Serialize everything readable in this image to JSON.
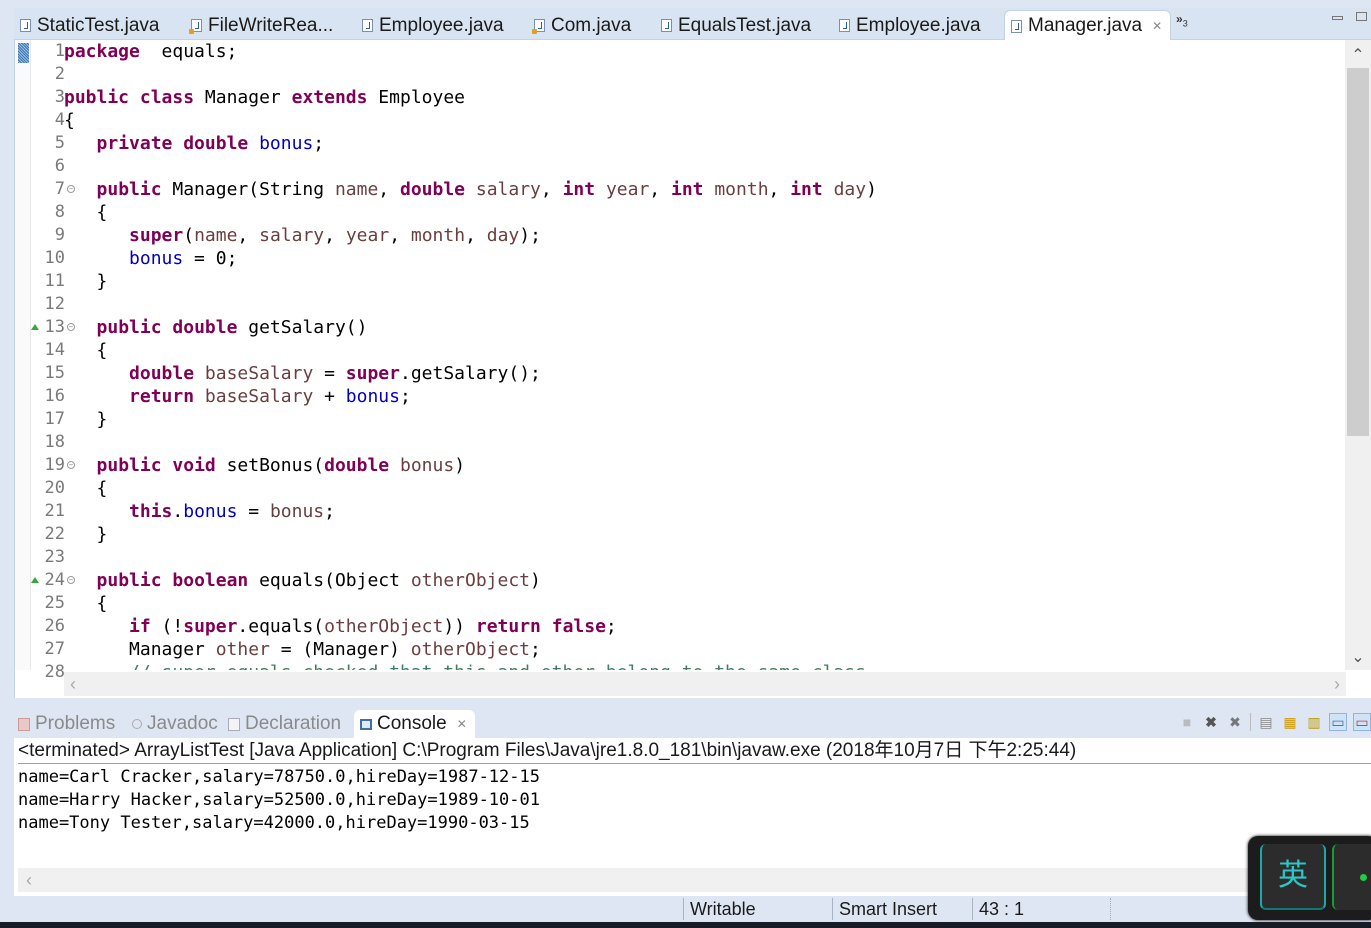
{
  "editor_tabs": [
    {
      "label": "StaticTest.java",
      "icon": "java-file-icon",
      "warning": false,
      "active": false
    },
    {
      "label": "FileWriteRea...",
      "icon": "java-file-icon",
      "warning": true,
      "active": false
    },
    {
      "label": "Employee.java",
      "icon": "java-file-icon",
      "warning": false,
      "active": false
    },
    {
      "label": "Com.java",
      "icon": "java-file-icon",
      "warning": true,
      "active": false
    },
    {
      "label": "EqualsTest.java",
      "icon": "java-file-icon",
      "warning": false,
      "active": false
    },
    {
      "label": "Employee.java",
      "icon": "java-file-icon",
      "warning": false,
      "active": false
    },
    {
      "label": "Manager.java",
      "icon": "java-file-icon",
      "warning": false,
      "active": true
    }
  ],
  "tab_close_glyph": "✕",
  "tab_overflow": {
    "glyph": "»",
    "count": "3"
  },
  "editor": {
    "line_numbers": [
      "1",
      "2",
      "3",
      "4",
      "5",
      "6",
      "7",
      "8",
      "9",
      "10",
      "11",
      "12",
      "13",
      "14",
      "15",
      "16",
      "17",
      "18",
      "19",
      "20",
      "21",
      "22",
      "23",
      "24",
      "25",
      "26",
      "27",
      "28"
    ],
    "fold_lines": [
      7,
      13,
      19,
      24
    ],
    "override_lines": [
      13,
      24
    ],
    "code_lines": [
      [
        [
          "kw",
          "package"
        ],
        [
          "",
          "  equals;"
        ]
      ],
      [],
      [
        [
          "kw",
          "public"
        ],
        [
          "",
          " "
        ],
        [
          "kw",
          "class"
        ],
        [
          "",
          " Manager "
        ],
        [
          "kw",
          "extends"
        ],
        [
          "",
          " Employee"
        ]
      ],
      [
        [
          "",
          "{"
        ]
      ],
      [
        [
          "",
          "   "
        ],
        [
          "kw",
          "private"
        ],
        [
          "",
          " "
        ],
        [
          "kw",
          "double"
        ],
        [
          "",
          " "
        ],
        [
          "fld",
          "bonus"
        ],
        [
          "",
          ";"
        ]
      ],
      [],
      [
        [
          "",
          "   "
        ],
        [
          "kw",
          "public"
        ],
        [
          "",
          " Manager(String "
        ],
        [
          "var",
          "name"
        ],
        [
          "",
          ", "
        ],
        [
          "kw",
          "double"
        ],
        [
          "",
          " "
        ],
        [
          "var",
          "salary"
        ],
        [
          "",
          ", "
        ],
        [
          "kw",
          "int"
        ],
        [
          "",
          " "
        ],
        [
          "var",
          "year"
        ],
        [
          "",
          ", "
        ],
        [
          "kw",
          "int"
        ],
        [
          "",
          " "
        ],
        [
          "var",
          "month"
        ],
        [
          "",
          ", "
        ],
        [
          "kw",
          "int"
        ],
        [
          "",
          " "
        ],
        [
          "var",
          "day"
        ],
        [
          "",
          ")"
        ]
      ],
      [
        [
          "",
          "   {"
        ]
      ],
      [
        [
          "",
          "      "
        ],
        [
          "kw",
          "super"
        ],
        [
          "",
          "("
        ],
        [
          "var",
          "name"
        ],
        [
          "",
          ", "
        ],
        [
          "var",
          "salary"
        ],
        [
          "",
          ", "
        ],
        [
          "var",
          "year"
        ],
        [
          "",
          ", "
        ],
        [
          "var",
          "month"
        ],
        [
          "",
          ", "
        ],
        [
          "var",
          "day"
        ],
        [
          "",
          ");"
        ]
      ],
      [
        [
          "",
          "      "
        ],
        [
          "fld",
          "bonus"
        ],
        [
          "",
          " = 0;"
        ]
      ],
      [
        [
          "",
          "   }"
        ]
      ],
      [],
      [
        [
          "",
          "   "
        ],
        [
          "kw",
          "public"
        ],
        [
          "",
          " "
        ],
        [
          "kw",
          "double"
        ],
        [
          "",
          " getSalary()"
        ]
      ],
      [
        [
          "",
          "   {"
        ]
      ],
      [
        [
          "",
          "      "
        ],
        [
          "kw",
          "double"
        ],
        [
          "",
          " "
        ],
        [
          "var",
          "baseSalary"
        ],
        [
          "",
          " = "
        ],
        [
          "kw",
          "super"
        ],
        [
          "",
          ".getSalary();"
        ]
      ],
      [
        [
          "",
          "      "
        ],
        [
          "kw",
          "return"
        ],
        [
          "",
          " "
        ],
        [
          "var",
          "baseSalary"
        ],
        [
          "",
          " + "
        ],
        [
          "fld",
          "bonus"
        ],
        [
          "",
          ";"
        ]
      ],
      [
        [
          "",
          "   }"
        ]
      ],
      [],
      [
        [
          "",
          "   "
        ],
        [
          "kw",
          "public"
        ],
        [
          "",
          " "
        ],
        [
          "kw",
          "void"
        ],
        [
          "",
          " setBonus("
        ],
        [
          "kw",
          "double"
        ],
        [
          "",
          " "
        ],
        [
          "var",
          "bonus"
        ],
        [
          "",
          ")"
        ]
      ],
      [
        [
          "",
          "   {"
        ]
      ],
      [
        [
          "",
          "      "
        ],
        [
          "kw",
          "this"
        ],
        [
          "",
          "."
        ],
        [
          "fld",
          "bonus"
        ],
        [
          "",
          " = "
        ],
        [
          "var",
          "bonus"
        ],
        [
          "",
          ";"
        ]
      ],
      [
        [
          "",
          "   }"
        ]
      ],
      [],
      [
        [
          "",
          "   "
        ],
        [
          "kw",
          "public"
        ],
        [
          "",
          " "
        ],
        [
          "kw",
          "boolean"
        ],
        [
          "",
          " equals(Object "
        ],
        [
          "var",
          "otherObject"
        ],
        [
          "",
          ")"
        ]
      ],
      [
        [
          "",
          "   {"
        ]
      ],
      [
        [
          "",
          "      "
        ],
        [
          "kw",
          "if"
        ],
        [
          "",
          " (!"
        ],
        [
          "kw",
          "super"
        ],
        [
          "",
          ".equals("
        ],
        [
          "var",
          "otherObject"
        ],
        [
          "",
          ")) "
        ],
        [
          "kw",
          "return"
        ],
        [
          "",
          " "
        ],
        [
          "kw",
          "false"
        ],
        [
          "",
          ";"
        ]
      ],
      [
        [
          "",
          "      Manager "
        ],
        [
          "var",
          "other"
        ],
        [
          "",
          " = (Manager) "
        ],
        [
          "var",
          "otherObject"
        ],
        [
          "",
          ";"
        ]
      ],
      [
        [
          "",
          "      "
        ],
        [
          "cmt",
          "// super.equals checked that this and other belong to the same class"
        ]
      ]
    ]
  },
  "bottom_panel": {
    "tabs": [
      {
        "label": "Problems",
        "icon": "problems-icon",
        "active": false
      },
      {
        "label": "Javadoc",
        "icon": "javadoc-icon",
        "active": false
      },
      {
        "label": "Declaration",
        "icon": "declaration-icon",
        "active": false
      },
      {
        "label": "Console",
        "icon": "console-icon",
        "active": true
      }
    ],
    "toolbar": [
      "terminate-icon",
      "remove-launch-icon",
      "remove-all-terminated-icon",
      "clear-console-icon",
      "scroll-lock-icon",
      "word-wrap-icon",
      "show-console-on-output-icon",
      "display-selected-console-icon"
    ],
    "console_header": "<terminated> ArrayListTest [Java Application] C:\\Program Files\\Java\\jre1.8.0_181\\bin\\javaw.exe (2018年10月7日 下午2:25:44)",
    "console_output": [
      "name=Carl Cracker,salary=78750.0,hireDay=1987-12-15",
      "name=Harry Hacker,salary=52500.0,hireDay=1989-10-01",
      "name=Tony Tester,salary=42000.0,hireDay=1990-03-15"
    ]
  },
  "statusbar": {
    "writable": "Writable",
    "insert_mode": "Smart Insert",
    "position": "43 : 1"
  },
  "ime": {
    "mode": "英"
  },
  "scroll_glyphs": {
    "up": "⌃",
    "down": "⌄",
    "left": "‹",
    "right": "›"
  },
  "colors": {
    "keyword": "#7f0055",
    "field": "#0000c0",
    "variable": "#6a3e3e",
    "comment": "#3f7f5f",
    "chrome": "#dfe6f3"
  }
}
